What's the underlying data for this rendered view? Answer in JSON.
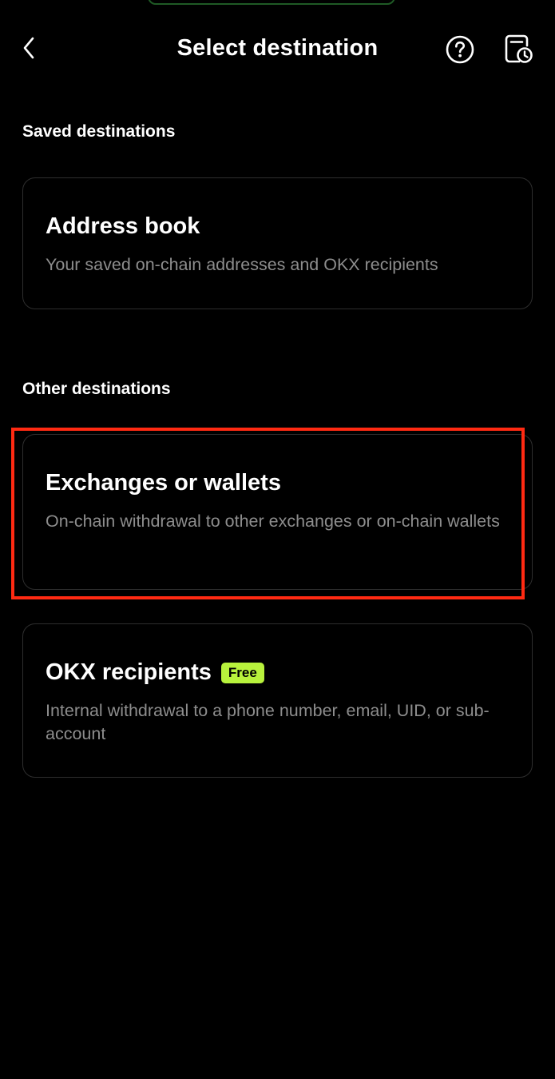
{
  "header": {
    "title": "Select destination",
    "back_icon": "chevron-left-icon",
    "help_icon": "help-circle-icon",
    "history_icon": "history-clock-icon"
  },
  "sections": {
    "saved": {
      "title": "Saved destinations",
      "address_book": {
        "title": "Address book",
        "description": "Your saved on-chain addresses and OKX recipients"
      }
    },
    "other": {
      "title": "Other destinations",
      "exchanges": {
        "title": "Exchanges or wallets",
        "description": "On-chain withdrawal to other exchanges or on-chain wallets"
      },
      "okx_recipients": {
        "title": "OKX recipients",
        "badge": "Free",
        "description": "Internal withdrawal to a phone number, email, UID, or sub-account"
      }
    }
  },
  "colors": {
    "background": "#000000",
    "card_border": "#2e2e2e",
    "secondary_text": "#8d8d8d",
    "badge_bg": "#b8f23c",
    "highlight": "#ff2a12"
  }
}
